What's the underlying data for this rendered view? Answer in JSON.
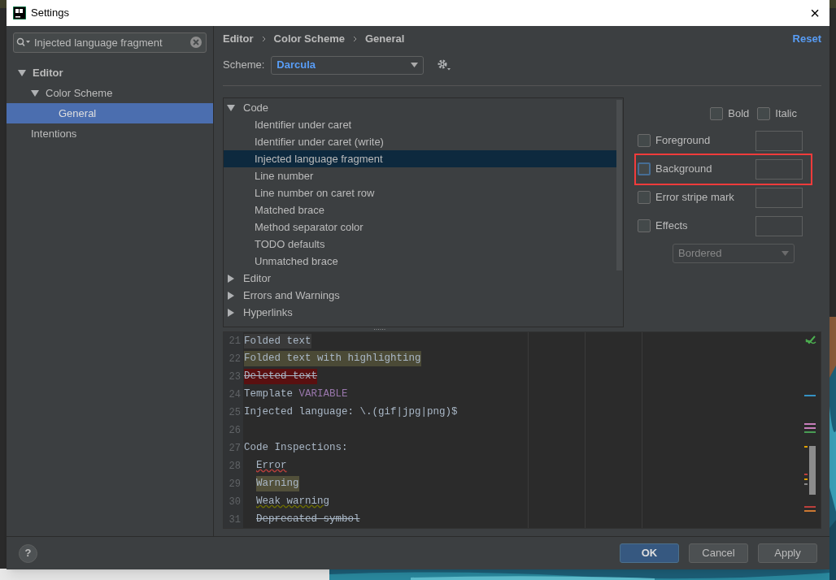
{
  "window": {
    "title": "Settings",
    "close": "×"
  },
  "search": {
    "value": "Injected language fragment"
  },
  "sidebar": {
    "items": [
      {
        "label": "Editor",
        "expanded": true,
        "selected": false,
        "children": [
          {
            "label": "Color Scheme",
            "expanded": true,
            "selected": false,
            "children": [
              {
                "label": "General",
                "selected": true
              }
            ]
          },
          {
            "label": "Intentions",
            "selected": false
          }
        ]
      }
    ]
  },
  "breadcrumb": [
    "Editor",
    "Color Scheme",
    "General"
  ],
  "reset": "Reset",
  "scheme": {
    "label": "Scheme:",
    "value": "Darcula"
  },
  "tree": [
    {
      "label": "Code",
      "expanded": true,
      "children": [
        {
          "label": "Identifier under caret",
          "selected": false
        },
        {
          "label": "Identifier under caret (write)",
          "selected": false
        },
        {
          "label": "Injected language fragment",
          "selected": true
        },
        {
          "label": "Line number",
          "selected": false
        },
        {
          "label": "Line number on caret row",
          "selected": false
        },
        {
          "label": "Matched brace",
          "selected": false
        },
        {
          "label": "Method separator color",
          "selected": false
        },
        {
          "label": "TODO defaults",
          "selected": false
        },
        {
          "label": "Unmatched brace",
          "selected": false
        }
      ]
    },
    {
      "label": "Editor",
      "expanded": false
    },
    {
      "label": "Errors and Warnings",
      "expanded": false
    },
    {
      "label": "Hyperlinks",
      "expanded": false
    }
  ],
  "font_style": [
    {
      "label": "Bold",
      "checked": false
    },
    {
      "label": "Italic",
      "checked": false
    }
  ],
  "attributes": [
    {
      "label": "Foreground",
      "checked": false,
      "highlighted": false
    },
    {
      "label": "Background",
      "checked": false,
      "highlighted": true
    },
    {
      "label": "Error stripe mark",
      "checked": false,
      "highlighted": false
    },
    {
      "label": "Effects",
      "checked": false,
      "highlighted": false
    }
  ],
  "effect_type": {
    "value": "Bordered",
    "disabled": true
  },
  "preview": [
    {
      "number": "21",
      "indented": false,
      "segments": [
        {
          "text": "Folded text",
          "kind": "folded"
        }
      ]
    },
    {
      "number": "22",
      "indented": false,
      "segments": [
        {
          "text": "Folded text with highlighting",
          "kind": "highlight"
        }
      ]
    },
    {
      "number": "23",
      "indented": false,
      "segments": [
        {
          "text": "Deleted text",
          "kind": "deleted"
        }
      ]
    },
    {
      "number": "24",
      "indented": false,
      "segments": [
        {
          "text": "Template",
          "kind": "plain"
        },
        {
          "text": "VARIABLE",
          "kind": "variable"
        }
      ]
    },
    {
      "number": "25",
      "indented": false,
      "segments": [
        {
          "text": "Injected language: \\.(gif|jpg|png)$",
          "kind": "plain"
        }
      ]
    },
    {
      "number": "26"
    },
    {
      "number": "27",
      "indented": false,
      "segments": [
        {
          "text": "Code Inspections:",
          "kind": "plain"
        }
      ]
    },
    {
      "number": "28",
      "indented": true,
      "segments": [
        {
          "text": "Error",
          "kind": "error"
        }
      ]
    },
    {
      "number": "29",
      "indented": true,
      "segments": [
        {
          "text": "Warning",
          "kind": "warning"
        }
      ]
    },
    {
      "number": "30",
      "indented": true,
      "segments": [
        {
          "text": "Weak warning",
          "kind": "weak"
        }
      ]
    },
    {
      "number": "31",
      "indented": true,
      "segments": [
        {
          "text": "Deprecated symbol",
          "kind": "deprecated"
        }
      ]
    }
  ],
  "footer": {
    "help": "?",
    "buttons": [
      {
        "label": "OK",
        "primary": true
      },
      {
        "label": "Cancel",
        "primary": false
      },
      {
        "label": "Apply",
        "primary": false
      }
    ]
  }
}
